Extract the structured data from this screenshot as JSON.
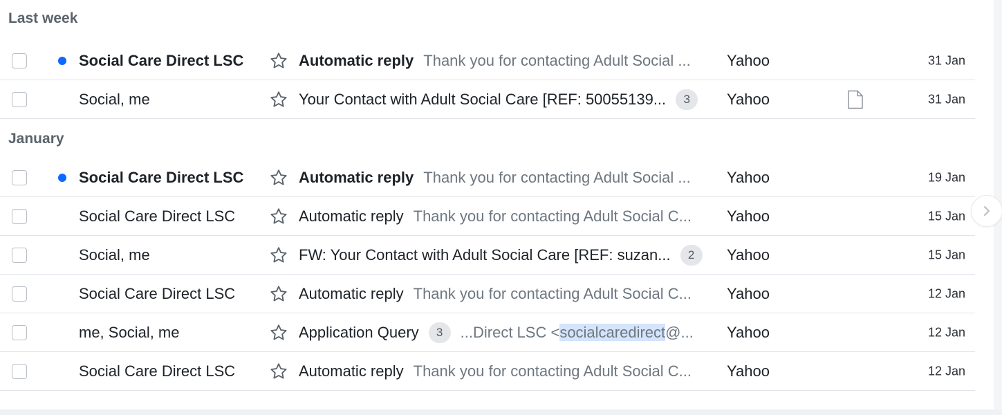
{
  "groups": [
    {
      "label": "Last week",
      "rows": [
        {
          "unread": true,
          "sender": "Social Care Direct LSC",
          "subject": "Automatic reply",
          "preview": "Thank you for contacting Adult Social ...",
          "account": "Yahoo",
          "date": "31 Jan"
        },
        {
          "unread": false,
          "sender": "Social, me",
          "subject": "Your Contact with Adult Social Care [REF: 50055139...",
          "count": "3",
          "account": "Yahoo",
          "has_attachment": true,
          "date": "31 Jan"
        }
      ]
    },
    {
      "label": "January",
      "rows": [
        {
          "unread": true,
          "sender": "Social Care Direct LSC",
          "subject": "Automatic reply",
          "preview": "Thank you for contacting Adult Social ...",
          "account": "Yahoo",
          "date": "19 Jan"
        },
        {
          "unread": false,
          "sender": "Social Care Direct LSC",
          "subject": "Automatic reply",
          "preview": "Thank you for contacting Adult Social C...",
          "account": "Yahoo",
          "date": "15 Jan"
        },
        {
          "unread": false,
          "sender": "Social, me",
          "subject": "FW: Your Contact with Adult Social Care [REF: suzan...",
          "count": "2",
          "account": "Yahoo",
          "date": "15 Jan"
        },
        {
          "unread": false,
          "sender": "Social Care Direct LSC",
          "subject": "Automatic reply",
          "preview": "Thank you for contacting Adult Social C...",
          "account": "Yahoo",
          "date": "12 Jan"
        },
        {
          "unread": false,
          "sender": "me, Social, me",
          "subject": "Application Query",
          "count": "3",
          "preview_before": "...Direct LSC <",
          "preview_highlight": "socialcaredirect",
          "preview_after": "@...",
          "account": "Yahoo",
          "date": "12 Jan"
        },
        {
          "unread": false,
          "sender": "Social Care Direct LSC",
          "subject": "Automatic reply",
          "preview": "Thank you for contacting Adult Social C...",
          "account": "Yahoo",
          "date": "12 Jan"
        }
      ]
    }
  ],
  "icons": {
    "star": "star-outline-icon",
    "attachment": "document-icon",
    "next": "chevron-right-icon"
  },
  "colors": {
    "unread_dot": "#0f69ff",
    "search_highlight": "#d3e4fb",
    "row_divider": "#e0e4e9",
    "preview_text": "#6e7780"
  }
}
